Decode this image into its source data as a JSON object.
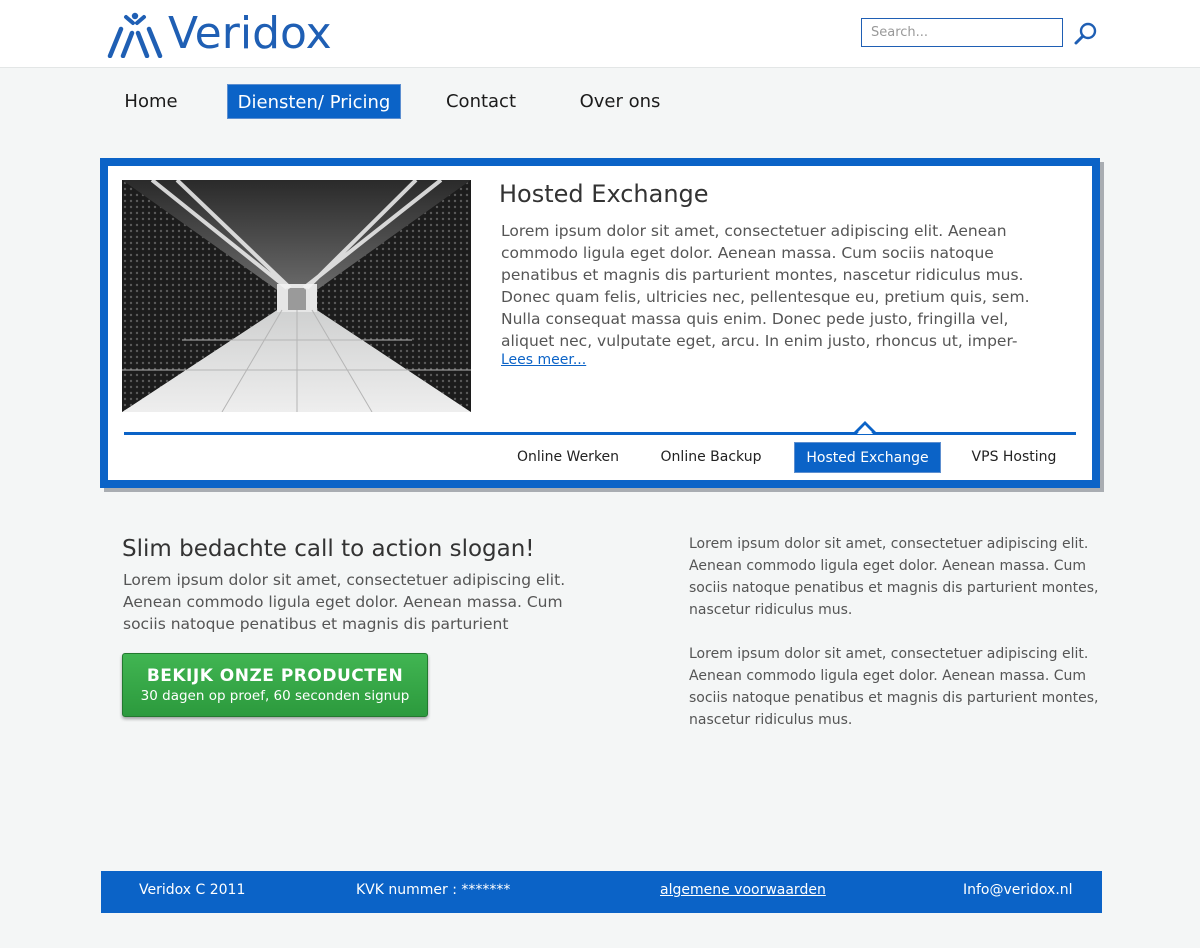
{
  "header": {
    "logo_text": "Veridox",
    "search_placeholder": "Search..."
  },
  "nav": {
    "items": [
      {
        "label": "Home"
      },
      {
        "label": "Diensten/ Pricing"
      },
      {
        "label": "Contact"
      },
      {
        "label": "Over ons"
      }
    ],
    "active": "Diensten/ Pricing"
  },
  "feature": {
    "title": "Hosted Exchange",
    "body": "Lorem ipsum dolor sit amet, consectetuer adipiscing elit. Aenean commodo ligula eget dolor. Aenean massa. Cum sociis natoque penatibus et magnis dis parturient montes, nascetur ridiculus mus. Donec quam felis, ultricies nec, pellentesque eu, pretium quis, sem. Nulla consequat massa quis enim. Donec pede justo, fringilla vel, aliquet nec, vulputate eget, arcu. In enim justo, rhoncus ut, imper-",
    "more_link": "Lees meer...",
    "tabs": [
      {
        "label": "Online Werken"
      },
      {
        "label": "Online Backup"
      },
      {
        "label": "Hosted Exchange"
      },
      {
        "label": "VPS Hosting"
      }
    ],
    "active_tab": "Hosted Exchange"
  },
  "cta": {
    "title": "Slim bedachte call to action slogan!",
    "body": "Lorem ipsum dolor sit amet, consectetuer adipiscing elit. Aenean commodo ligula eget dolor. Aenean massa. Cum sociis natoque penatibus et magnis dis parturient",
    "button_title": "BEKIJK ONZE PRODUCTEN",
    "button_sub": "30 dagen op proef, 60 seconden signup"
  },
  "side": {
    "paragraphs": [
      "Lorem ipsum dolor sit amet, consectetuer adipiscing elit. Aenean commodo ligula eget dolor. Aenean massa. Cum sociis natoque penatibus et magnis dis parturient montes, nascetur ridiculus mus.",
      "Lorem ipsum dolor sit amet, consectetuer adipiscing elit. Aenean commodo ligula eget dolor. Aenean massa. Cum sociis natoque penatibus et magnis dis parturient montes, nascetur ridiculus mus."
    ]
  },
  "footer": {
    "copyright": "Veridox C 2011",
    "kvk": "KVK nummer : *******",
    "terms": "algemene voorwaarden",
    "email": "Info@veridox.nl"
  },
  "colors": {
    "brand_blue": "#0b63c7",
    "cta_green": "#2c9a3d",
    "background": "#f4f6f6"
  }
}
